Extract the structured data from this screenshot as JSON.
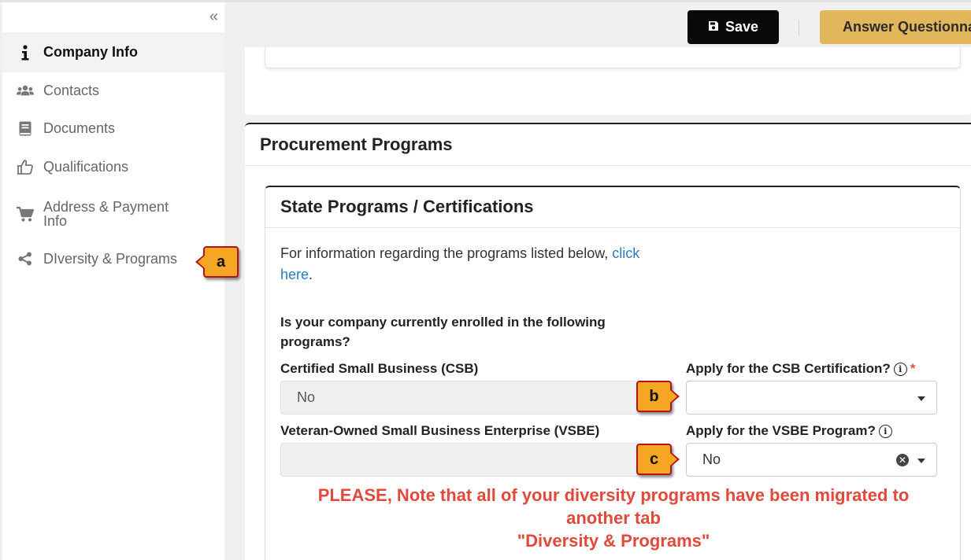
{
  "sidebar": {
    "collapse_glyph": "«",
    "items": [
      {
        "label": "Company Info",
        "icon": "info-icon",
        "active": true
      },
      {
        "label": "Contacts",
        "icon": "users-icon"
      },
      {
        "label": "Documents",
        "icon": "book-icon"
      },
      {
        "label": "Qualifications",
        "icon": "thumbs-up-icon"
      },
      {
        "label_line1": "Address & Payment",
        "label_line2": "Info",
        "icon": "cart-icon"
      },
      {
        "label": "DIversity & Programs",
        "icon": "share-icon"
      }
    ]
  },
  "toolbar": {
    "save_label": "Save",
    "divider": "|",
    "answer_label": "Answer Questionnaire"
  },
  "procurement": {
    "title": "Procurement Programs",
    "state_card": {
      "title": "State Programs / Certifications",
      "info_prefix": "For information regarding the programs listed below, ",
      "info_link": "click here",
      "info_suffix": ".",
      "question": "Is your company currently enrolled in the following programs?",
      "csb_label": "Certified Small Business (CSB)",
      "csb_value": "No",
      "csb_apply_label": "Apply for the CSB Certification?",
      "csb_apply_value": "",
      "vsbe_label": "Veteran-Owned Small Business Enterprise (VSBE)",
      "vsbe_value": "",
      "vsbe_apply_label": "Apply for the VSBE Program?",
      "vsbe_apply_value": "No",
      "required_mark": "*",
      "notice_line1": "PLEASE, Note that all of your diversity programs have been migrated to",
      "notice_line2": "another tab",
      "notice_line3": "\"Diversity & Programs\""
    }
  },
  "callouts": {
    "a": "a",
    "b": "b",
    "c": "c"
  },
  "colors": {
    "accent_gold": "#e2b65a",
    "callout_fill": "#f5a623",
    "callout_border": "#b31217",
    "notice_red": "#e2493a",
    "link_blue": "#2a7bbf"
  }
}
